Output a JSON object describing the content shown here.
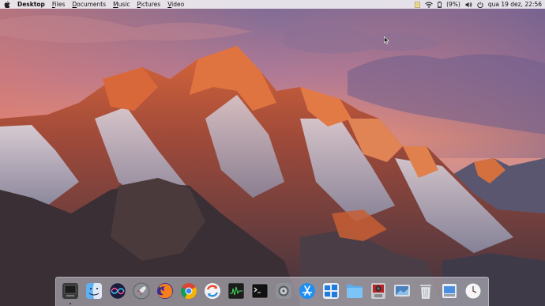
{
  "menubar": {
    "apple_icon": "apple-logo-icon",
    "active_app": "Desktop",
    "menus": [
      {
        "label": "Files",
        "mnemonic": "F"
      },
      {
        "label": "Documents",
        "mnemonic": "D"
      },
      {
        "label": "Music",
        "mnemonic": "M"
      },
      {
        "label": "Pictures",
        "mnemonic": "P"
      },
      {
        "label": "Video",
        "mnemonic": "V"
      }
    ],
    "status": {
      "battery_text": "(9%)",
      "datetime": "qua 19 dez, 22:56",
      "icons": [
        "notes-icon",
        "wifi-icon",
        "battery-icon",
        "volume-icon",
        "power-icon"
      ]
    }
  },
  "desktop": {
    "wallpaper": "mountain-sunset-wallpaper",
    "colors": {
      "sky_top": "#6b5a86",
      "sky_glow": "#e98a78",
      "peak_lit": "#d8663a",
      "snow": "#c9cde0",
      "rock_dark": "#3a2f35"
    }
  },
  "dock": {
    "items": [
      {
        "name": "show-desktop",
        "icon": "monitor-icon"
      },
      {
        "name": "finder",
        "icon": "finder-face-icon"
      },
      {
        "name": "siri",
        "icon": "siri-icon"
      },
      {
        "name": "launchpad",
        "icon": "rocket-icon"
      },
      {
        "name": "firefox",
        "icon": "firefox-icon"
      },
      {
        "name": "chrome",
        "icon": "chrome-icon"
      },
      {
        "name": "software-center",
        "icon": "refresh-circle-icon"
      },
      {
        "name": "system-monitor",
        "icon": "activity-graph-icon"
      },
      {
        "name": "terminal",
        "icon": "terminal-icon"
      },
      {
        "name": "system-settings",
        "icon": "gear-icon"
      },
      {
        "name": "app-store",
        "icon": "app-store-icon"
      },
      {
        "name": "boot-camp",
        "icon": "windows-icon"
      },
      {
        "name": "files-folder",
        "icon": "folder-icon"
      },
      {
        "name": "photo-booth",
        "icon": "photo-booth-icon"
      },
      {
        "name": "screenshot",
        "icon": "screenshot-icon"
      },
      {
        "name": "trash",
        "icon": "trash-icon"
      },
      {
        "name": "downloads",
        "icon": "download-stack-icon"
      },
      {
        "name": "clock",
        "icon": "clock-icon"
      }
    ]
  }
}
